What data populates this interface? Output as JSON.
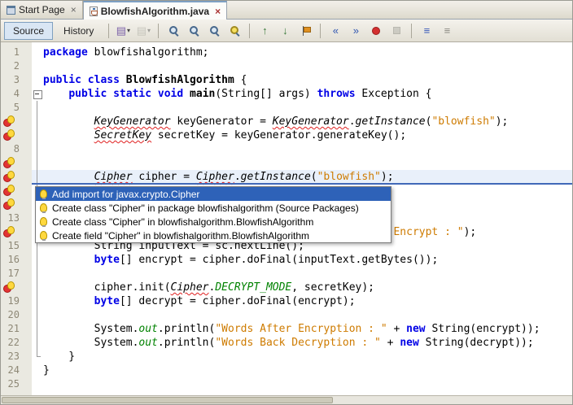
{
  "icons": {
    "close": "×",
    "dropdown": "▾"
  },
  "tabs": [
    {
      "label": "Start Page",
      "active": false
    },
    {
      "label": "BlowfishAlgorithm.java",
      "active": true
    }
  ],
  "toolbar": {
    "source_label": "Source",
    "history_label": "History",
    "icons": [
      {
        "name": "last-edited",
        "type": "char",
        "char": "▤",
        "color": "#7a5fa8",
        "dropdown": true
      },
      {
        "name": "go-back",
        "type": "char",
        "char": "▤",
        "color": "#9a9a92",
        "dropdown": true,
        "enabled": false
      },
      {
        "sep": true
      },
      {
        "name": "find-selection",
        "type": "magnifier"
      },
      {
        "name": "find-next-occurrence",
        "type": "magnifier"
      },
      {
        "name": "find-previous-occurrence",
        "type": "magnifier"
      },
      {
        "name": "toggle-highlight-search",
        "type": "magnifier",
        "variant": "hl"
      },
      {
        "sep": true
      },
      {
        "name": "previous-bookmark",
        "type": "char",
        "char": "↑",
        "color": "#3a7a3a"
      },
      {
        "name": "next-bookmark",
        "type": "char",
        "char": "↓",
        "color": "#3a7a3a"
      },
      {
        "name": "toggle-bookmark",
        "type": "flag"
      },
      {
        "sep": true
      },
      {
        "name": "shift-line-left",
        "type": "char",
        "char": "«",
        "color": "#2f55b0"
      },
      {
        "name": "shift-line-right",
        "type": "char",
        "char": "»",
        "color": "#2f55b0"
      },
      {
        "name": "start-macro-recording",
        "type": "record"
      },
      {
        "name": "stop-macro-recording",
        "type": "stop",
        "enabled": false
      },
      {
        "sep": true
      },
      {
        "name": "comment",
        "type": "char",
        "char": "≡",
        "color": "#3858b8"
      },
      {
        "name": "uncomment",
        "type": "char",
        "char": "≡",
        "color": "#8a8a82"
      }
    ]
  },
  "popup": {
    "items": [
      {
        "label": "Add import for javax.crypto.Cipher",
        "selected": true
      },
      {
        "label": "Create class \"Cipher\" in package blowfishalgorithm (Source Packages)",
        "selected": false
      },
      {
        "label": "Create class \"Cipher\" in blowfishalgorithm.BlowfishAlgorithm",
        "selected": false
      },
      {
        "label": "Create field \"Cipher\" in blowfishalgorithm.BlowfishAlgorithm",
        "selected": false
      }
    ]
  },
  "editor": {
    "current_line": 10,
    "lines": [
      {
        "n": 1,
        "seg": [
          [
            "package",
            "k"
          ],
          [
            " blowfishalgorithm;",
            "p"
          ]
        ]
      },
      {
        "n": 2,
        "seg": []
      },
      {
        "n": 3,
        "seg": [
          [
            "public",
            "k"
          ],
          [
            " ",
            "p"
          ],
          [
            "class",
            "k"
          ],
          [
            " ",
            "p"
          ],
          [
            "BlowfishAlgorithm",
            "t"
          ],
          [
            " {",
            "p"
          ]
        ]
      },
      {
        "n": 4,
        "fold": "start",
        "seg": [
          [
            "    ",
            "p"
          ],
          [
            "public",
            "k"
          ],
          [
            " ",
            "p"
          ],
          [
            "static",
            "k"
          ],
          [
            " ",
            "p"
          ],
          [
            "void",
            "k"
          ],
          [
            " ",
            "p"
          ],
          [
            "main",
            "t"
          ],
          [
            "(String[] args) ",
            "p"
          ],
          [
            "throws",
            "k"
          ],
          [
            " Exception {",
            "p"
          ]
        ]
      },
      {
        "n": 5,
        "fold": "line",
        "seg": []
      },
      {
        "n": 6,
        "fold": "line",
        "icon": true,
        "seg": [
          [
            "        ",
            "p"
          ],
          [
            "KeyGenerator",
            "e"
          ],
          [
            " keyGenerator = ",
            "p"
          ],
          [
            "KeyGenerator",
            "e"
          ],
          [
            ".",
            "p"
          ],
          [
            "getInstance",
            "m"
          ],
          [
            "(",
            "p"
          ],
          [
            "\"blowfish\"",
            "s"
          ],
          [
            ");",
            "p"
          ]
        ]
      },
      {
        "n": 7,
        "fold": "line",
        "icon": true,
        "seg": [
          [
            "        ",
            "p"
          ],
          [
            "SecretKey",
            "e"
          ],
          [
            " secretKey = keyGenerator.generateKey();",
            "p"
          ]
        ]
      },
      {
        "n": 8,
        "fold": "line",
        "seg": []
      },
      {
        "n": 9,
        "fold": "line",
        "icon": true,
        "seg": []
      },
      {
        "n": 10,
        "fold": "line",
        "icon": true,
        "seg": [
          [
            "        ",
            "p"
          ],
          [
            "Cipher",
            "e"
          ],
          [
            " cipher = ",
            "p"
          ],
          [
            "Cipher",
            "e"
          ],
          [
            ".",
            "p"
          ],
          [
            "getInstance",
            "m"
          ],
          [
            "(",
            "p"
          ],
          [
            "\"blowfish\"",
            "s"
          ],
          [
            ");",
            "p"
          ]
        ]
      },
      {
        "n": 11,
        "fold": "line",
        "icon": true,
        "seg": []
      },
      {
        "n": 12,
        "fold": "line",
        "icon": true,
        "seg": []
      },
      {
        "n": 13,
        "fold": "line",
        "seg": []
      },
      {
        "n": 14,
        "fold": "line",
        "icon": true,
        "seg": [
          [
            "                                                       ",
            "p"
          ],
          [
            "Encrypt : \"",
            "s"
          ],
          [
            ");",
            "p"
          ]
        ]
      },
      {
        "n": 15,
        "fold": "line",
        "seg": [
          [
            "        String inputText = sc.nextLine();",
            "p"
          ]
        ]
      },
      {
        "n": 16,
        "fold": "line",
        "seg": [
          [
            "        ",
            "p"
          ],
          [
            "byte",
            "k"
          ],
          [
            "[] encrypt = cipher.doFinal(inputText.getBytes());",
            "p"
          ]
        ]
      },
      {
        "n": 17,
        "fold": "line",
        "seg": []
      },
      {
        "n": 18,
        "fold": "line",
        "icon": true,
        "seg": [
          [
            "        cipher.init(",
            "p"
          ],
          [
            "Cipher",
            "e"
          ],
          [
            ".",
            "p"
          ],
          [
            "DECRYPT_MODE",
            "f"
          ],
          [
            ", secretKey);",
            "p"
          ]
        ]
      },
      {
        "n": 19,
        "fold": "line",
        "seg": [
          [
            "        ",
            "p"
          ],
          [
            "byte",
            "k"
          ],
          [
            "[] decrypt = cipher.doFinal(encrypt);",
            "p"
          ]
        ]
      },
      {
        "n": 20,
        "fold": "line",
        "seg": []
      },
      {
        "n": 21,
        "fold": "line",
        "seg": [
          [
            "        System.",
            "p"
          ],
          [
            "out",
            "f"
          ],
          [
            ".println(",
            "p"
          ],
          [
            "\"Words After Encryption : \"",
            "s"
          ],
          [
            " + ",
            "p"
          ],
          [
            "new",
            "k"
          ],
          [
            " String(encrypt));",
            "p"
          ]
        ]
      },
      {
        "n": 22,
        "fold": "line",
        "seg": [
          [
            "        System.",
            "p"
          ],
          [
            "out",
            "f"
          ],
          [
            ".println(",
            "p"
          ],
          [
            "\"Words Back Decryption : \"",
            "s"
          ],
          [
            " + ",
            "p"
          ],
          [
            "new",
            "k"
          ],
          [
            " String(decrypt));",
            "p"
          ]
        ]
      },
      {
        "n": 23,
        "fold": "end",
        "seg": [
          [
            "    }",
            "p"
          ]
        ]
      },
      {
        "n": 24,
        "seg": [
          [
            "}",
            "p"
          ]
        ]
      },
      {
        "n": 25,
        "seg": []
      }
    ]
  },
  "colors": {
    "selection_blue": "#2e62b8",
    "keyword": "#0000e6",
    "string": "#ce7b00",
    "error_underline": "#e02020",
    "static_field_green": "#008200",
    "current_line_border": "#4169b8"
  }
}
